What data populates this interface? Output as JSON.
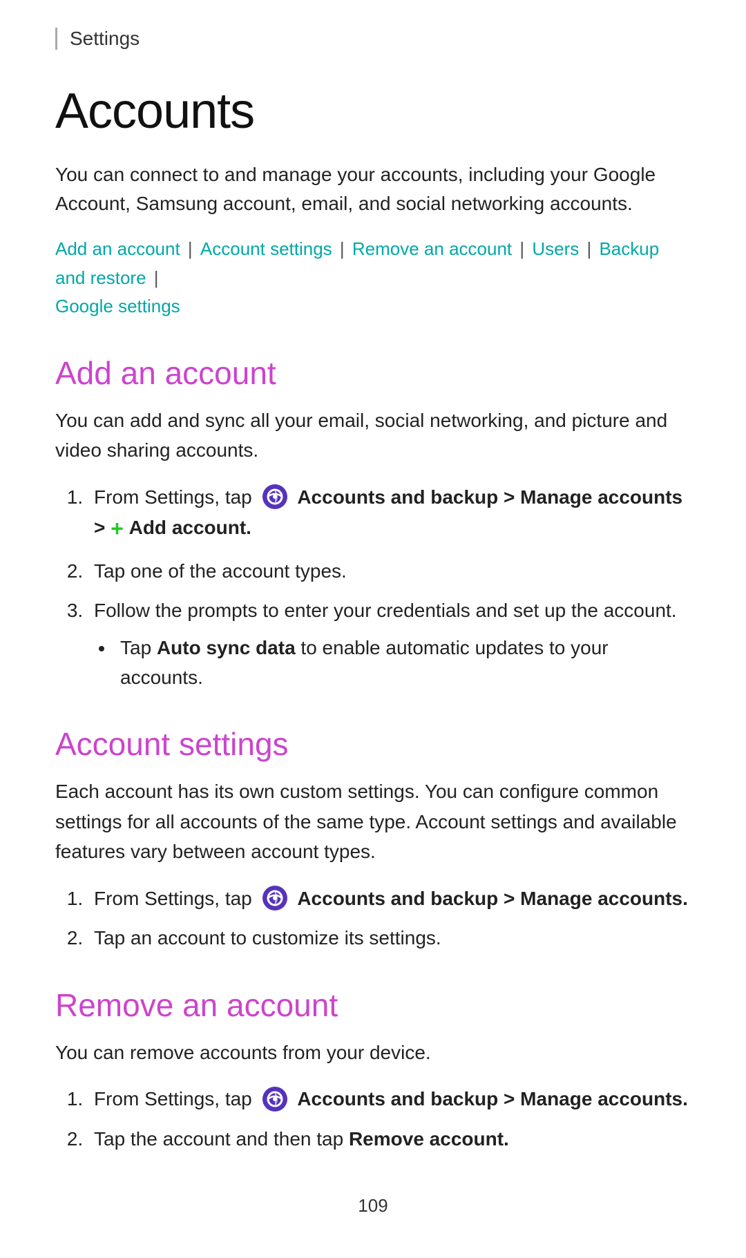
{
  "header": {
    "settings_label": "Settings"
  },
  "page": {
    "title": "Accounts",
    "intro": "You can connect to and manage your accounts, including your Google Account, Samsung account, email, and social networking accounts.",
    "footer_page": "109"
  },
  "nav_links": {
    "add_account": "Add an account",
    "account_settings": "Account settings",
    "remove_account": "Remove an account",
    "users": "Users",
    "backup_restore": "Backup and restore",
    "google_settings": "Google settings"
  },
  "sections": {
    "add_account": {
      "title": "Add an account",
      "intro": "You can add and sync all your email, social networking, and picture and video sharing accounts.",
      "steps": [
        {
          "id": 1,
          "text_before": "From Settings, tap",
          "bold_text": "Accounts and backup > Manage accounts >",
          "plus": "+ Add account.",
          "has_icon": true
        },
        {
          "id": 2,
          "text": "Tap one of the account types."
        },
        {
          "id": 3,
          "text": "Follow the prompts to enter your credentials and set up the account."
        }
      ],
      "bullet": {
        "text_before": "Tap",
        "bold_text": "Auto sync data",
        "text_after": "to enable automatic updates to your accounts."
      }
    },
    "account_settings": {
      "title": "Account settings",
      "intro": "Each account has its own custom settings. You can configure common settings for all accounts of the same type. Account settings and available features vary between account types.",
      "steps": [
        {
          "id": 1,
          "text_before": "From Settings, tap",
          "bold_text": "Accounts and backup > Manage accounts.",
          "has_icon": true
        },
        {
          "id": 2,
          "text": "Tap an account to customize its settings."
        }
      ]
    },
    "remove_account": {
      "title": "Remove an account",
      "intro": "You can remove accounts from your device.",
      "steps": [
        {
          "id": 1,
          "text_before": "From Settings, tap",
          "bold_text": "Accounts and backup > Manage accounts.",
          "has_icon": true
        },
        {
          "id": 2,
          "text_before": "Tap the account and then tap",
          "bold_text": "Remove account."
        }
      ]
    }
  }
}
